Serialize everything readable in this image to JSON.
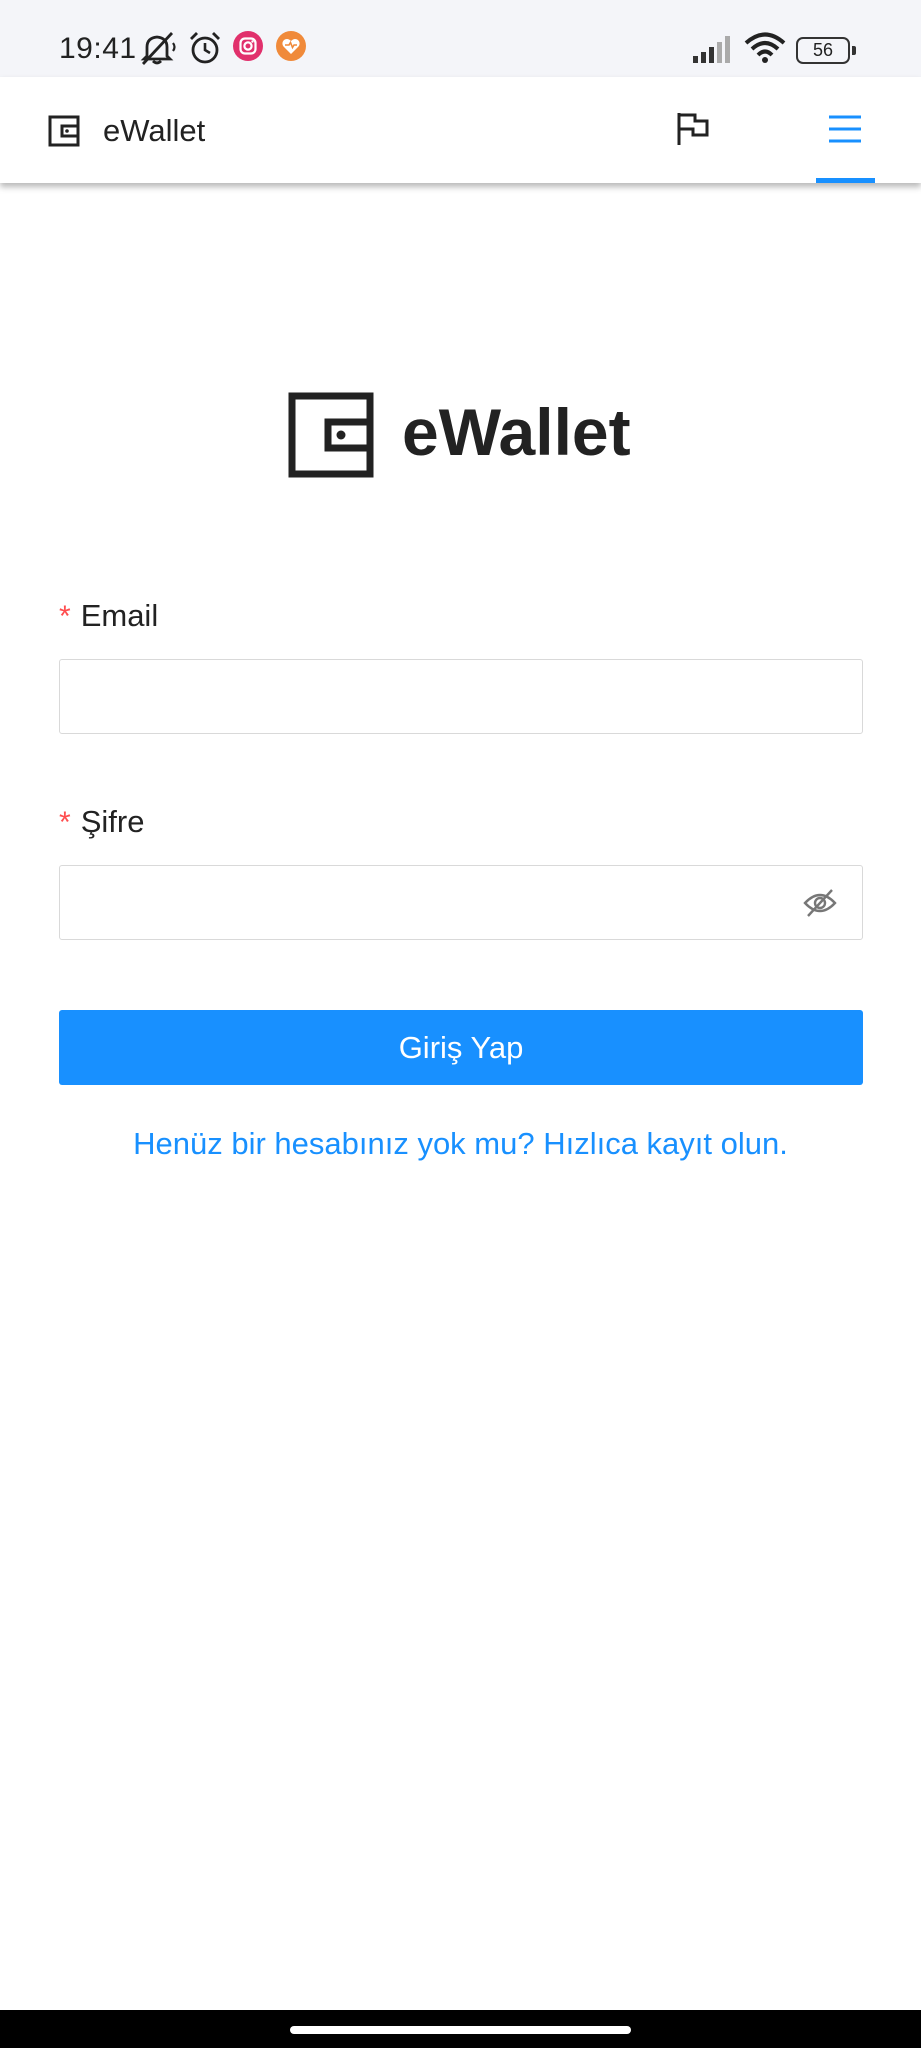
{
  "status_bar": {
    "time": "19:41",
    "battery_level": "56",
    "icons": [
      "muted-bell-icon",
      "alarm-icon",
      "instagram-icon",
      "health-app-icon",
      "signal-icon",
      "wifi-icon",
      "battery-icon"
    ]
  },
  "navbar": {
    "title": "eWallet",
    "icons": [
      "wallet-icon",
      "flag-icon",
      "menu-icon"
    ]
  },
  "brand": {
    "name": "eWallet"
  },
  "form": {
    "email": {
      "required_mark": "*",
      "label": "Email",
      "value": "",
      "placeholder": ""
    },
    "password": {
      "required_mark": "*",
      "label": "Şifre",
      "value": "",
      "placeholder": ""
    },
    "submit_label": "Giriş Yap",
    "register_link": "Henüz bir hesabınız yok mu? Hızlıca kayıt olun."
  },
  "colors": {
    "primary": "#1890ff",
    "required": "#ff4d4f",
    "status_bar_bg": "#f4f5f9",
    "text": "#222222"
  }
}
